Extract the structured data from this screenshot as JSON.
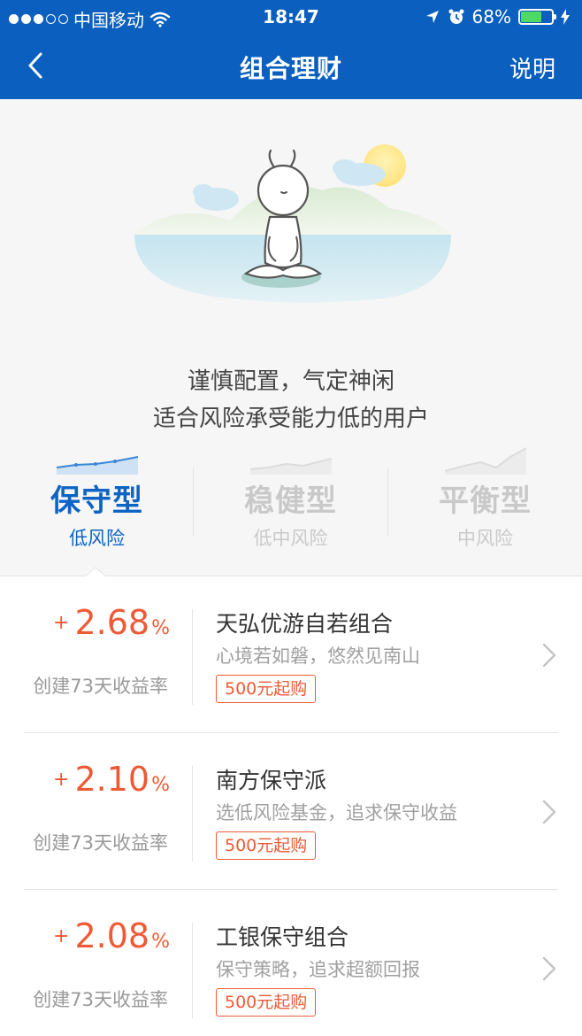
{
  "status_bar": {
    "carrier": "中国移动",
    "time": "18:47",
    "battery": "68%",
    "battery_level": 0.68,
    "signal_dots_filled": 3,
    "signal_dots_total": 5
  },
  "navbar": {
    "title": "组合理财",
    "help_label": "说明",
    "back_icon": "chevron-left-icon"
  },
  "hero": {
    "line1": "谨慎配置，气定神闲",
    "line2": "适合风险承受能力低的用户"
  },
  "tabs": [
    {
      "name": "保守型",
      "risk": "低风险",
      "active": true
    },
    {
      "name": "稳健型",
      "risk": "低中风险",
      "active": false
    },
    {
      "name": "平衡型",
      "risk": "中风险",
      "active": false
    }
  ],
  "portfolios": [
    {
      "plus": "+",
      "yield": "2.68",
      "unit": "%",
      "yield_label": "创建73天收益率",
      "name": "天弘优游自若组合",
      "desc": "心境若如磐，悠然见南山",
      "min_buy": "500元起购"
    },
    {
      "plus": "+",
      "yield": "2.10",
      "unit": "%",
      "yield_label": "创建73天收益率",
      "name": "南方保守派",
      "desc": "选低风险基金，追求保守收益",
      "min_buy": "500元起购"
    },
    {
      "plus": "+",
      "yield": "2.08",
      "unit": "%",
      "yield_label": "创建73天收益率",
      "name": "工银保守组合",
      "desc": "保守策略，追求超额回报",
      "min_buy": "500元起购"
    }
  ],
  "colors": {
    "brand_blue": "#0a5fbf",
    "active_tab": "#0d64c4",
    "yield_red": "#ee5a35",
    "battery_green": "#4cd964"
  }
}
